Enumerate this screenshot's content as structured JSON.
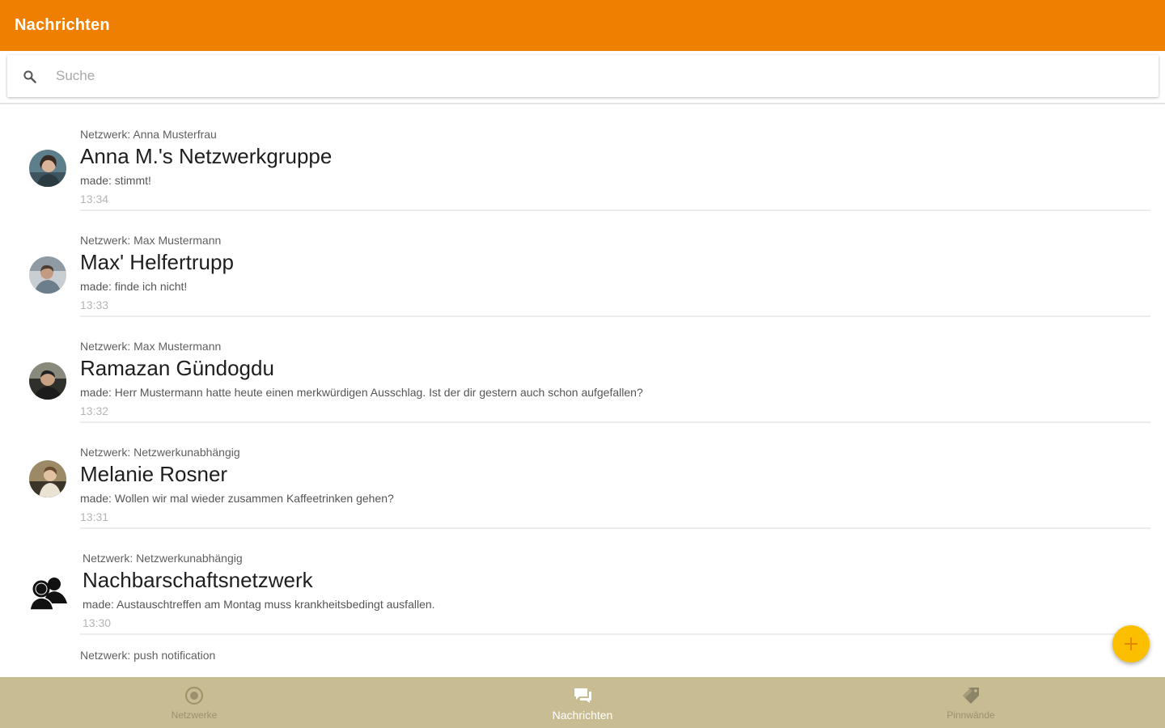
{
  "app_bar": {
    "title": "Nachrichten"
  },
  "search": {
    "placeholder": "Suche",
    "value": ""
  },
  "messages": [
    {
      "network": "Netzwerk: Anna Musterfrau",
      "title": "Anna M.'s Netzwerkgruppe",
      "preview": "made: stimmt!",
      "time": "13:34",
      "avatar": "photo"
    },
    {
      "network": "Netzwerk: Max Mustermann",
      "title": "Max' Helfertrupp",
      "preview": "made: finde ich nicht!",
      "time": "13:33",
      "avatar": "photo"
    },
    {
      "network": "Netzwerk: Max Mustermann",
      "title": "Ramazan Gündogdu",
      "preview": "made: Herr Mustermann hatte heute einen merkwürdigen Ausschlag. Ist der dir gestern auch schon aufgefallen?",
      "time": "13:32",
      "avatar": "photo"
    },
    {
      "network": "Netzwerk: Netzwerkunabhängig",
      "title": "Melanie Rosner",
      "preview": "made: Wollen wir mal wieder zusammen Kaffeetrinken gehen?",
      "time": "13:31",
      "avatar": "photo"
    },
    {
      "network": "Netzwerk: Netzwerkunabhängig",
      "title": "Nachbarschaftsnetzwerk",
      "preview": "made: Austauschtreffen am Montag muss krankheitsbedingt ausfallen.",
      "time": "13:30",
      "avatar": "group-icon"
    },
    {
      "network": "Netzwerk: push notification",
      "title": "",
      "preview": "",
      "time": "",
      "avatar": "none"
    }
  ],
  "fab": {
    "icon": "plus-icon"
  },
  "bottom_nav": {
    "items": [
      {
        "label": "Netzwerke",
        "icon": "network-icon",
        "active": false
      },
      {
        "label": "Nachrichten",
        "icon": "chat-icon",
        "active": true
      },
      {
        "label": "Pinnwände",
        "icon": "tag-icon",
        "active": false
      }
    ]
  },
  "colors": {
    "app_bar": "#ef7f00",
    "bottom_nav": "#c8bc93",
    "fab": "#fbbf00"
  }
}
